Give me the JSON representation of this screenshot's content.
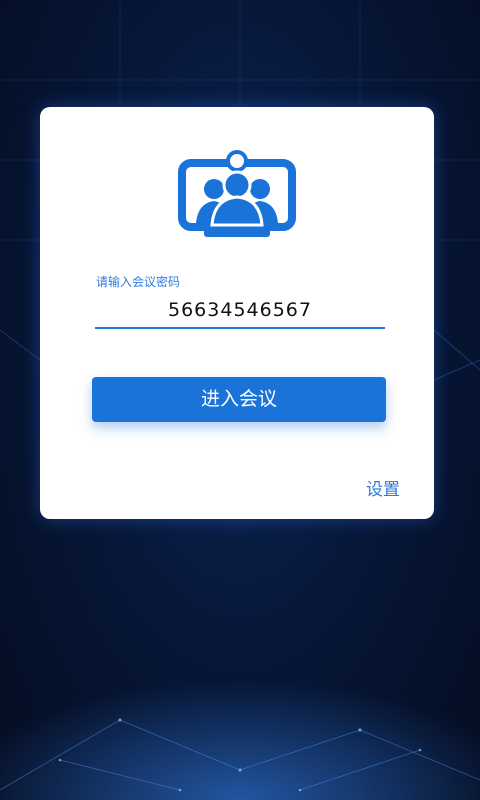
{
  "login": {
    "password_label": "请输入会议密码",
    "password_value": "56634546567",
    "enter_button_label": "进入会议",
    "settings_label": "设置"
  },
  "icons": {
    "logo": "video-conference-group-icon"
  },
  "colors": {
    "accent": "#1a73d9",
    "card_background": "#ffffff",
    "page_background": "#07183a"
  }
}
